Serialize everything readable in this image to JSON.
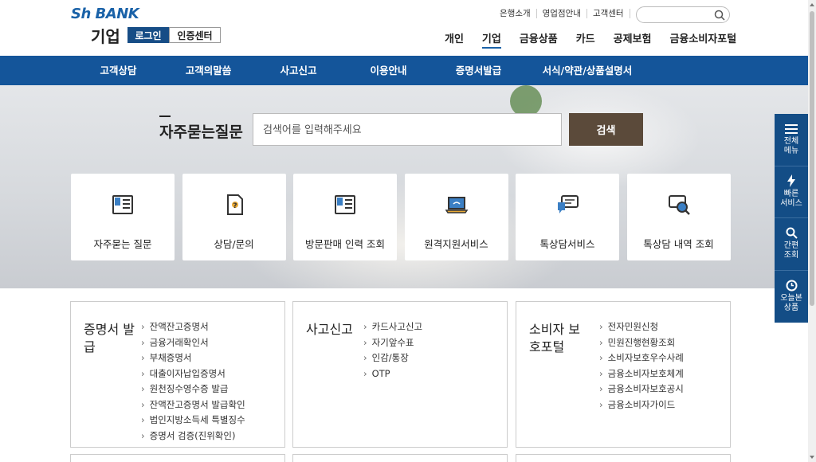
{
  "header": {
    "logo_bank": "Sh BANK",
    "logo_sub": "기업",
    "login_label": "로그인",
    "cert_label": "인증센터",
    "util_links": [
      "은행소개",
      "영업점안내",
      "고객센터"
    ],
    "gnb": [
      {
        "label": "개인",
        "active": false
      },
      {
        "label": "기업",
        "active": true
      },
      {
        "label": "금융상품",
        "active": false
      },
      {
        "label": "카드",
        "active": false
      },
      {
        "label": "공제보험",
        "active": false
      },
      {
        "label": "금융소비자포털",
        "active": false
      }
    ]
  },
  "subnav": [
    "고객상담",
    "고객의말씀",
    "사고신고",
    "이용안내",
    "증명서발급",
    "서식/약관/상품설명서"
  ],
  "hero": {
    "title": "자주묻는질문",
    "search_placeholder": "검색어를 입력해주세요",
    "search_button": "검색",
    "cards": [
      {
        "label": "자주묻는 질문",
        "icon": "faq-book-icon"
      },
      {
        "label": "상담/문의",
        "icon": "question-doc-icon"
      },
      {
        "label": "방문판매 인력 조회",
        "icon": "list-book-icon"
      },
      {
        "label": "원격지원서비스",
        "icon": "laptop-icon"
      },
      {
        "label": "톡상담서비스",
        "icon": "chat-icon"
      },
      {
        "label": "톡상담 내역 조회",
        "icon": "chat-search-icon"
      }
    ]
  },
  "boxes": [
    {
      "title": "증명서 발급",
      "items": [
        "잔액잔고증명서",
        "금융거래확인서",
        "부채증명서",
        "대출이자납입증명서",
        "원천징수영수증 발급",
        "잔액잔고증명서 발급확인",
        "법인지방소득세 특별징수",
        "증명서 검증(진위확인)"
      ]
    },
    {
      "title": "사고신고",
      "items": [
        "카드사고신고",
        "자기앞수표",
        "인감/통장",
        "OTP"
      ]
    },
    {
      "title": "소비자 보호포털",
      "items": [
        "전자민원신청",
        "민원진행현황조회",
        "소비자보호우수사례",
        "금융소비자보호체계",
        "금융소비자보호공시",
        "금융소비자가이드"
      ]
    }
  ],
  "quick": [
    {
      "line1": "전체",
      "line2": "메뉴",
      "icon": "hamburger-icon"
    },
    {
      "line1": "빠른",
      "line2": "서비스",
      "icon": "lightning-icon"
    },
    {
      "line1": "간편",
      "line2": "조회",
      "icon": "search-icon"
    },
    {
      "line1": "오늘본",
      "line2": "상품",
      "icon": "clock-icon"
    }
  ],
  "colors": {
    "brand": "#14559a",
    "search_button": "#5b4a3a"
  }
}
